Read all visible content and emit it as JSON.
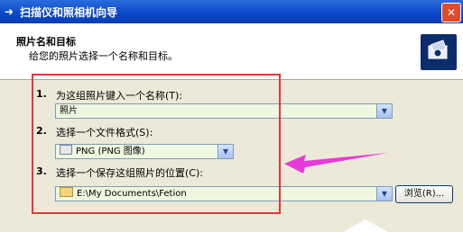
{
  "window": {
    "title": "扫描仪和照相机向导",
    "close_label": "✕"
  },
  "header": {
    "heading": "照片名和目标",
    "subheading": "给您的照片选择一个名称和目标。"
  },
  "steps": [
    {
      "number": "1.",
      "label": "为这组照片键入一个名称(T):",
      "value": "照片"
    },
    {
      "number": "2.",
      "label": "选择一个文件格式(S):",
      "value": "PNG (PNG 图像)"
    },
    {
      "number": "3.",
      "label": "选择一个保存这组照片的位置(C):",
      "value": "E:\\My Documents\\Fetion"
    }
  ],
  "browse_label": "浏览(R)...",
  "colors": {
    "annotation_box": "#e3363a",
    "arrow": "#e63ad6",
    "titlebar": "#0a46c8"
  }
}
